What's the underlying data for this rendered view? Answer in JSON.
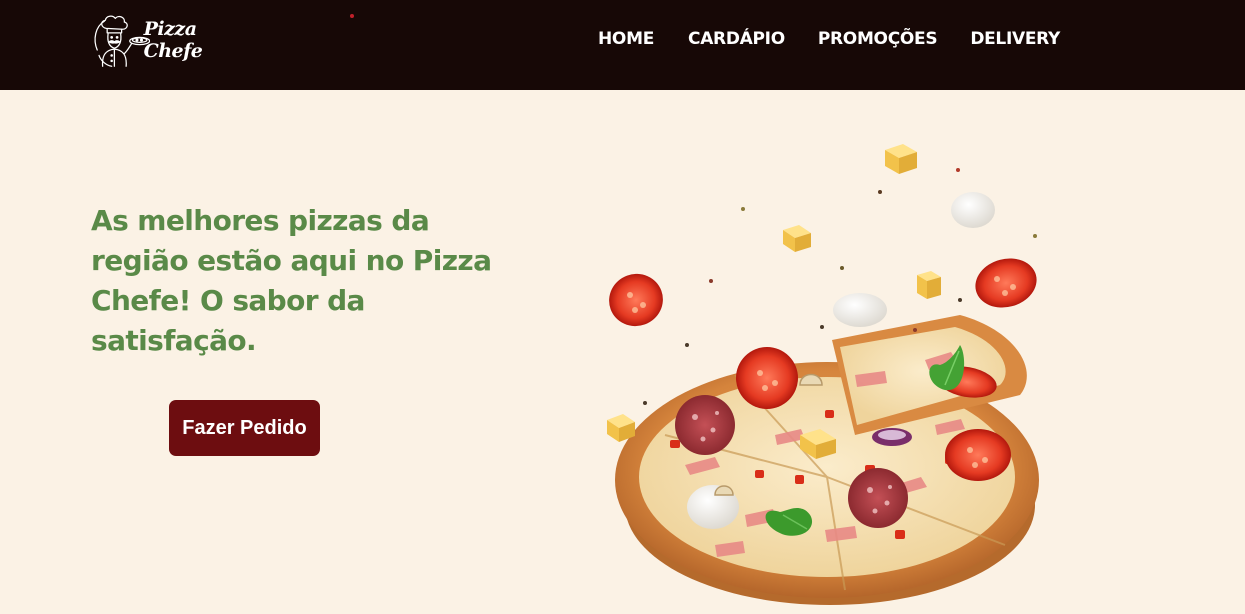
{
  "brand": {
    "name": "Pizza Chefe",
    "logo_icon": "chef-holding-pizza-icon"
  },
  "nav": {
    "items": [
      {
        "label": "HOME"
      },
      {
        "label": "CARDÁPIO"
      },
      {
        "label": "PROMOÇÕES"
      },
      {
        "label": "DELIVERY"
      }
    ]
  },
  "hero": {
    "title": "As melhores pizzas da região estão aqui no Pizza Chefe! O sabor da satisfação.",
    "cta_label": "Fazer Pedido",
    "image_icon": "pizza-with-flying-toppings-image"
  },
  "colors": {
    "navbar_bg": "#170806",
    "page_bg": "#fbf2e5",
    "title_green": "#5a8a48",
    "cta_bg": "#6d0d10"
  }
}
